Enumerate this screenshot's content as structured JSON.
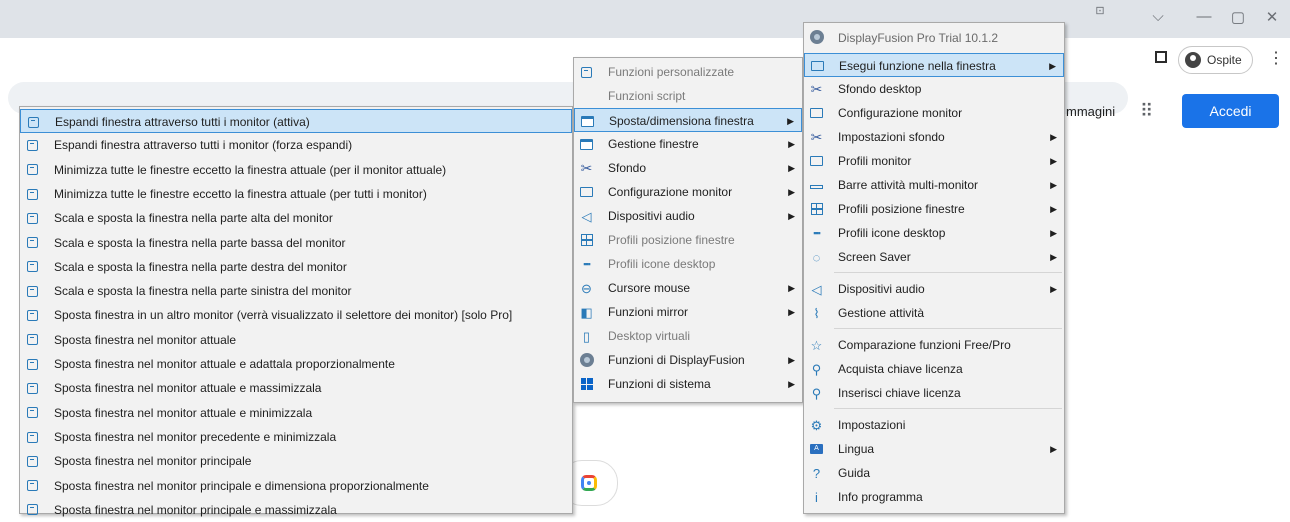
{
  "browser": {
    "window_controls": [
      "⌵",
      "—",
      "▢",
      "✕"
    ],
    "profile_label": "Ospite",
    "kebab": "⋮",
    "images_link": "mmagini",
    "apps_icon": "⠿",
    "signin_label": "Accedi"
  },
  "menu_left": {
    "items": [
      {
        "label": "Espandi finestra attraverso tutti i monitor (attiva)",
        "icon": "function-box-icon",
        "highlighted": true
      },
      {
        "label": "Espandi finestra attraverso tutti i monitor (forza espandi)",
        "icon": "function-box-icon"
      },
      {
        "label": "Minimizza tutte le finestre eccetto la finestra attuale (per il monitor attuale)",
        "icon": "function-box-icon"
      },
      {
        "label": "Minimizza tutte le finestre eccetto la finestra attuale (per tutti i monitor)",
        "icon": "function-box-icon"
      },
      {
        "label": "Scala e sposta la finestra nella parte alta del monitor",
        "icon": "function-box-icon"
      },
      {
        "label": "Scala e sposta la finestra nella parte bassa del monitor",
        "icon": "function-box-icon"
      },
      {
        "label": "Scala e sposta la finestra nella parte destra del monitor",
        "icon": "function-box-icon"
      },
      {
        "label": "Scala e sposta la finestra nella parte sinistra del monitor",
        "icon": "function-box-icon"
      },
      {
        "label": "Sposta finestra in un altro monitor (verrà visualizzato il selettore dei monitor) [solo Pro]",
        "icon": "function-box-icon"
      },
      {
        "label": "Sposta finestra nel monitor attuale",
        "icon": "function-box-icon"
      },
      {
        "label": "Sposta finestra nel monitor attuale e adattala proporzionalmente",
        "icon": "function-box-icon"
      },
      {
        "label": "Sposta finestra nel monitor attuale e massimizzala",
        "icon": "function-box-icon"
      },
      {
        "label": "Sposta finestra nel monitor attuale e minimizzala",
        "icon": "function-box-icon"
      },
      {
        "label": "Sposta finestra nel monitor precedente e minimizzala",
        "icon": "function-box-icon"
      },
      {
        "label": "Sposta finestra nel monitor principale",
        "icon": "function-box-icon"
      },
      {
        "label": "Sposta finestra nel monitor principale e dimensiona proporzionalmente",
        "icon": "function-box-icon"
      },
      {
        "label": "Sposta finestra nel monitor principale e massimizzala",
        "icon": "function-box-icon"
      }
    ]
  },
  "menu_middle": {
    "items": [
      {
        "label": "Funzioni personalizzate",
        "disabled": true,
        "icon": "function-box-icon"
      },
      {
        "label": "Funzioni script",
        "disabled": true,
        "icon": "code-icon",
        "glyph": "</>"
      },
      {
        "label": "Sposta/dimensiona finestra",
        "highlighted": true,
        "arrow": "▶",
        "icon": "window-icon"
      },
      {
        "label": "Gestione finestre",
        "arrow": "▶",
        "icon": "window-icon"
      },
      {
        "label": "Sfondo",
        "arrow": "▶",
        "icon": "wallpaper-tools-icon",
        "glyph": "✂"
      },
      {
        "label": "Configurazione monitor",
        "arrow": "▶",
        "icon": "monitor-icon"
      },
      {
        "label": "Dispositivi audio",
        "arrow": "▶",
        "icon": "speaker-icon",
        "glyph": "◁"
      },
      {
        "label": "Profili posizione finestre",
        "disabled": true,
        "icon": "grid-icon"
      },
      {
        "label": "Profili icone desktop",
        "disabled": true,
        "icon": "desktop-icons-icon",
        "glyph": "▪▪▪"
      },
      {
        "label": "Cursore mouse",
        "arrow": "▶",
        "icon": "mouse-icon",
        "glyph": "⊖"
      },
      {
        "label": "Funzioni mirror",
        "arrow": "▶",
        "icon": "mirror-icon",
        "glyph": "◧"
      },
      {
        "label": "Desktop virtuali",
        "disabled": true,
        "icon": "virtual-desktop-icon",
        "glyph": "▯"
      },
      {
        "label": "Funzioni di DisplayFusion",
        "arrow": "▶",
        "icon": "displayfusion-icon"
      },
      {
        "label": "Funzioni di sistema",
        "arrow": "▶",
        "icon": "windows-logo-icon"
      }
    ]
  },
  "menu_right": {
    "header": "DisplayFusion Pro Trial 10.1.2",
    "items": [
      {
        "label": "Esegui funzione nella finestra",
        "highlighted": true,
        "arrow": "▶",
        "icon": "monitor-icon"
      },
      {
        "label": "Sfondo desktop",
        "icon": "wallpaper-tools-icon",
        "glyph": "✂"
      },
      {
        "label": "Configurazione monitor",
        "icon": "monitor-icon"
      },
      {
        "label": "Impostazioni sfondo",
        "arrow": "▶",
        "icon": "wallpaper-tools-icon",
        "glyph": "✂"
      },
      {
        "label": "Profili monitor",
        "arrow": "▶",
        "icon": "monitor-icon"
      },
      {
        "label": "Barre attività multi-monitor",
        "arrow": "▶",
        "icon": "taskbar-icon"
      },
      {
        "label": "Profili posizione finestre",
        "arrow": "▶",
        "icon": "grid-icon"
      },
      {
        "label": "Profili icone desktop",
        "arrow": "▶",
        "icon": "desktop-icons-icon",
        "glyph": "▪▪▪"
      },
      {
        "label": "Screen Saver",
        "arrow": "▶",
        "icon": "screensaver-icon",
        "glyph": "◌"
      },
      {
        "label": "Dispositivi audio",
        "arrow": "▶",
        "icon": "speaker-icon",
        "glyph": "◁"
      },
      {
        "label": "Gestione attività",
        "icon": "task-manager-icon",
        "glyph": "⌇"
      },
      {
        "label": "Comparazione funzioni Free/Pro",
        "icon": "star-icon",
        "glyph": "☆"
      },
      {
        "label": "Acquista chiave licenza",
        "icon": "key-icon",
        "glyph": "⚲"
      },
      {
        "label": "Inserisci chiave licenza",
        "icon": "key-icon",
        "glyph": "⚲"
      },
      {
        "label": "Impostazioni",
        "icon": "gear-icon",
        "glyph": "⚙"
      },
      {
        "label": "Lingua",
        "arrow": "▶",
        "icon": "language-icon",
        "glyph": "A"
      },
      {
        "label": "Guida",
        "icon": "help-icon",
        "glyph": "?"
      },
      {
        "label": "Info programma",
        "icon": "info-icon",
        "glyph": "i"
      }
    ]
  }
}
